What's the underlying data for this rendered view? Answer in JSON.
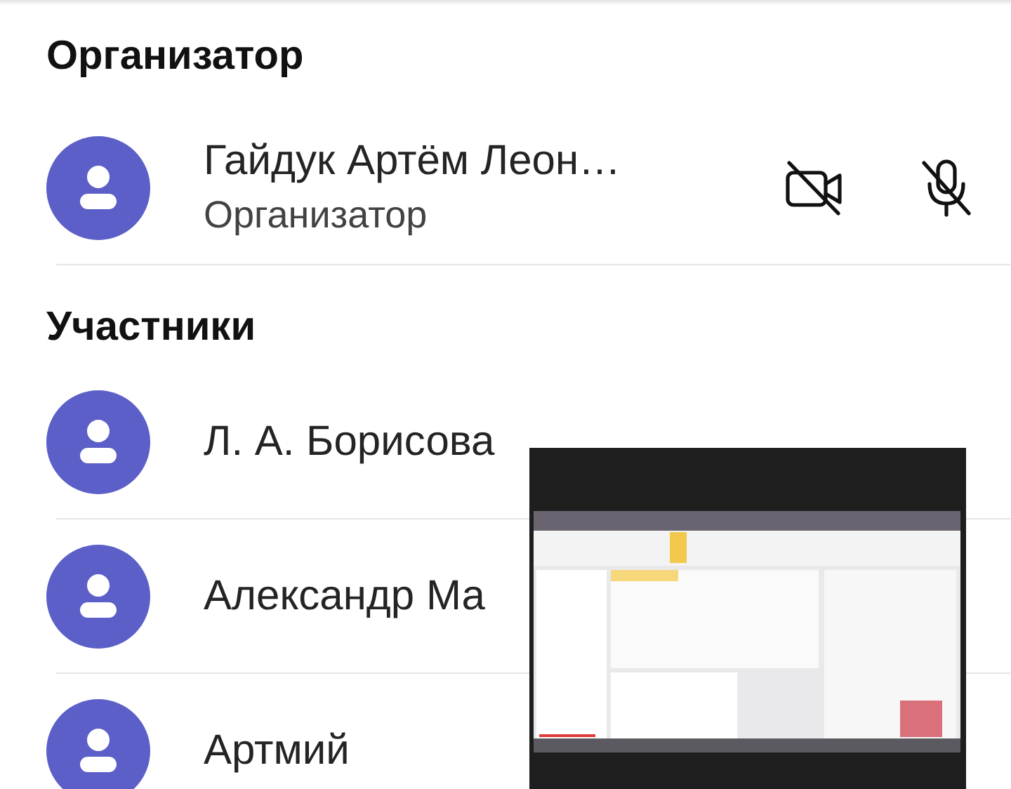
{
  "sections": [
    {
      "title": "Организатор",
      "people": [
        {
          "name": "Гайдук Артём Леон…",
          "role": "Организатор",
          "camera_off": true,
          "mic_off": true
        }
      ]
    },
    {
      "title": "Участники",
      "people": [
        {
          "name": "Л. А. Борисова"
        },
        {
          "name": "Александр Ма"
        },
        {
          "name": "Артмий"
        }
      ]
    }
  ]
}
